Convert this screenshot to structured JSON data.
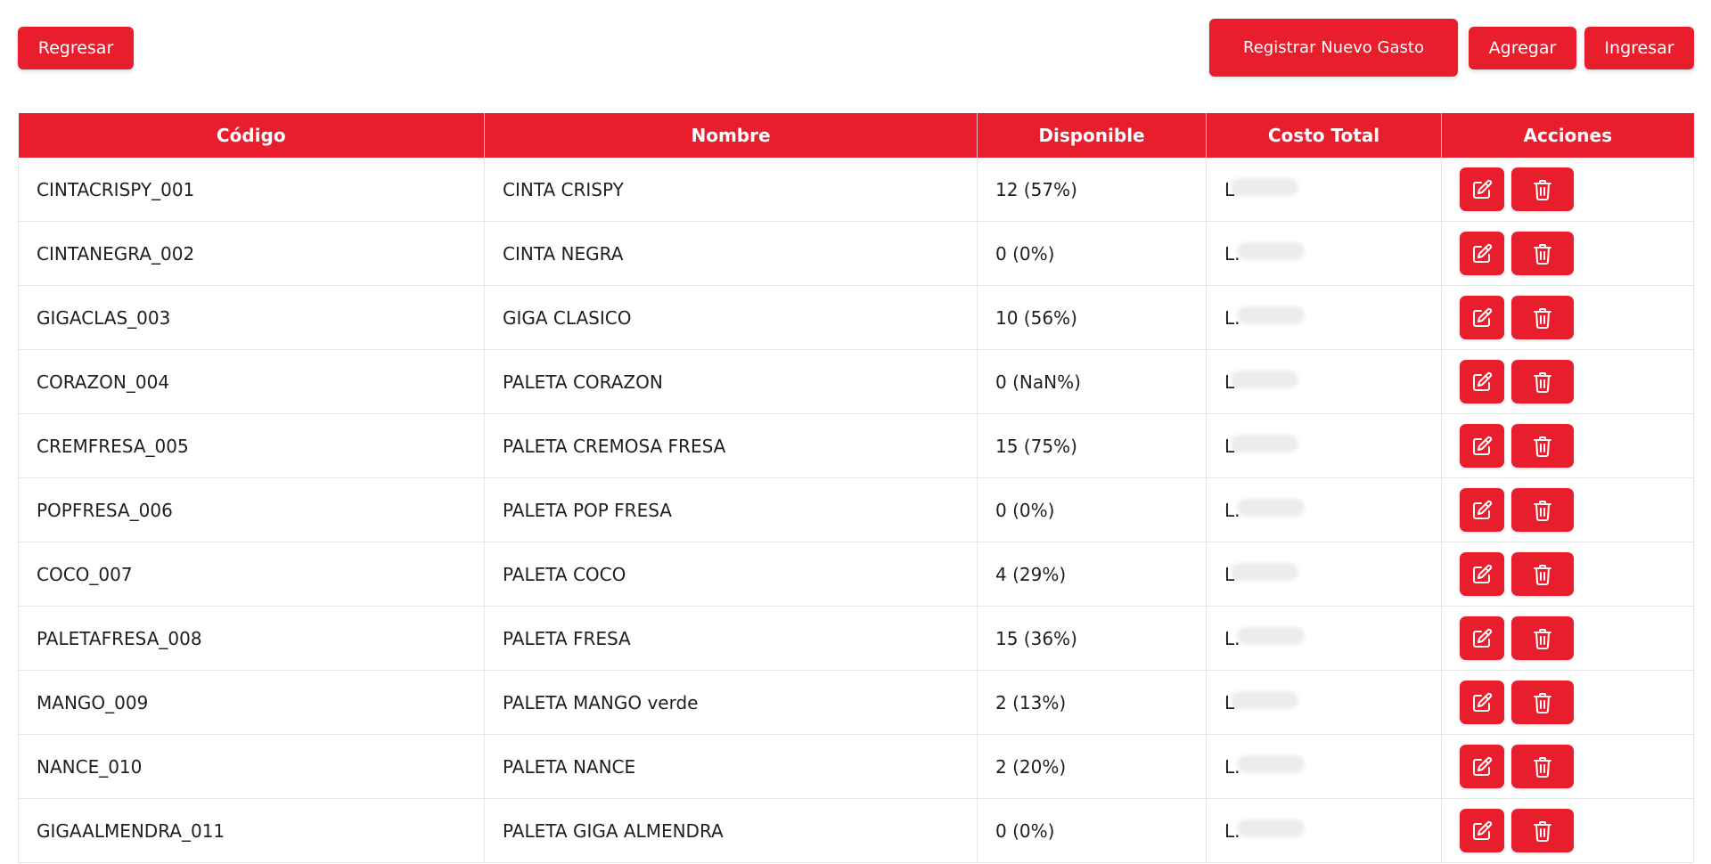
{
  "toolbar": {
    "back_label": "Regresar",
    "new_expense_label": "Registrar Nuevo Gasto",
    "add_label": "Agregar",
    "enter_label": "Ingresar"
  },
  "colors": {
    "accent": "#e81e2d",
    "row_border": "#e6e6e6"
  },
  "table": {
    "headers": [
      "Código",
      "Nombre",
      "Disponible",
      "Costo Total",
      "Acciones"
    ],
    "action_icons": [
      "edit-icon",
      "trash-icon"
    ],
    "rows": [
      {
        "codigo": "CINTACRISPY_001",
        "nombre": "CINTA CRISPY",
        "disponible": "12 (57%)",
        "costo_visible": "L"
      },
      {
        "codigo": "CINTANEGRA_002",
        "nombre": "CINTA NEGRA",
        "disponible": "0 (0%)",
        "costo_visible": "L."
      },
      {
        "codigo": "GIGACLAS_003",
        "nombre": "GIGA CLASICO",
        "disponible": "10 (56%)",
        "costo_visible": "L."
      },
      {
        "codigo": "CORAZON_004",
        "nombre": "PALETA CORAZON",
        "disponible": "0 (NaN%)",
        "costo_visible": "L"
      },
      {
        "codigo": "CREMFRESA_005",
        "nombre": "PALETA CREMOSA FRESA",
        "disponible": "15 (75%)",
        "costo_visible": "L"
      },
      {
        "codigo": "POPFRESA_006",
        "nombre": "PALETA POP FRESA",
        "disponible": "0 (0%)",
        "costo_visible": "L."
      },
      {
        "codigo": "COCO_007",
        "nombre": "PALETA COCO",
        "disponible": "4 (29%)",
        "costo_visible": "L"
      },
      {
        "codigo": "PALETAFRESA_008",
        "nombre": "PALETA FRESA",
        "disponible": "15 (36%)",
        "costo_visible": "L."
      },
      {
        "codigo": "MANGO_009",
        "nombre": "PALETA MANGO verde",
        "disponible": "2 (13%)",
        "costo_visible": "L"
      },
      {
        "codigo": "NANCE_010",
        "nombre": "PALETA NANCE",
        "disponible": "2 (20%)",
        "costo_visible": "L."
      },
      {
        "codigo": "GIGAALMENDRA_011",
        "nombre": "PALETA GIGA ALMENDRA",
        "disponible": "0 (0%)",
        "costo_visible": "L."
      }
    ]
  }
}
